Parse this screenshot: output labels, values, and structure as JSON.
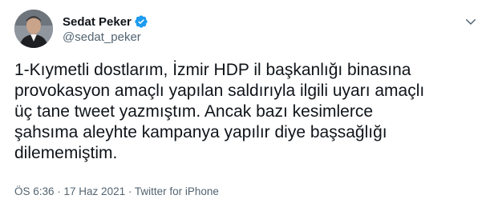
{
  "author": {
    "display_name": "Sedat Peker",
    "handle": "@sedat_peker",
    "verified": true
  },
  "tweet": {
    "lines": [
      "1-Kıymetli dostlarım, İzmir HDP il başkanlığı binasına",
      "provokasyon amaçlı yapılan saldırıyla ilgili uyarı amaçlı",
      "üç tane tweet yazmıştım. Ancak bazı kesimlerce",
      "şahsıma aleyhte kampanya yapılır diye başsağlığı",
      "dilememiştim."
    ],
    "time": "ÖS 6:36",
    "separator": " · ",
    "date": "17 Haz 2021",
    "source": "Twitter for iPhone"
  },
  "icons": {
    "verified": "verified-badge-icon",
    "more": "chevron-down-icon"
  },
  "colors": {
    "verified": "#1d9bf0",
    "secondary_text": "#536471",
    "primary_text": "#0f1419"
  }
}
